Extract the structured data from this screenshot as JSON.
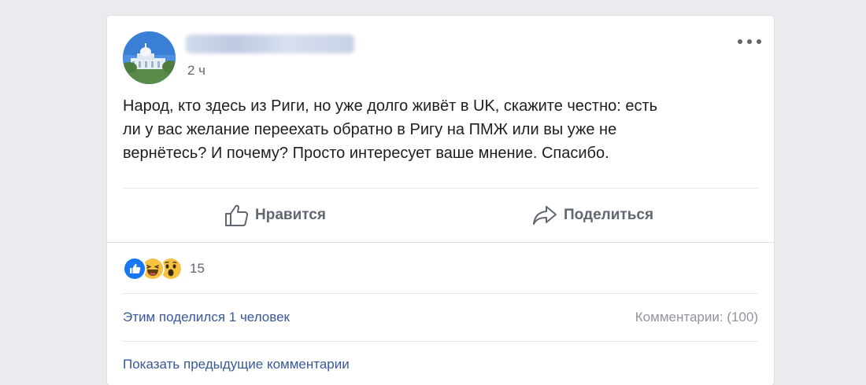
{
  "post": {
    "timestamp": "2 ч",
    "text_lines": [
      "Народ, кто здесь из Риги, но уже долго живёт в UK, скажите честно: есть",
      "ли у вас желание переехать обратно в Ригу на ПМЖ или вы уже не",
      "вернётесь? И почему? Просто интересует ваше мнение. Спасибо."
    ]
  },
  "actions": {
    "like_label": "Нравится",
    "share_label": "Поделиться"
  },
  "reactions": {
    "icons": [
      "like-icon",
      "haha-icon",
      "wow-icon"
    ],
    "count": "15"
  },
  "footer": {
    "shares_text": "Этим поделился 1 человек",
    "comments_text": "Комментарии: (100)",
    "previous_comments_link": "Показать предыдущие комментарии"
  },
  "colors": {
    "background": "#e9ebee",
    "link": "#385898",
    "like_blue": "#1877f2",
    "emoji_yellow": "#f7c142"
  }
}
